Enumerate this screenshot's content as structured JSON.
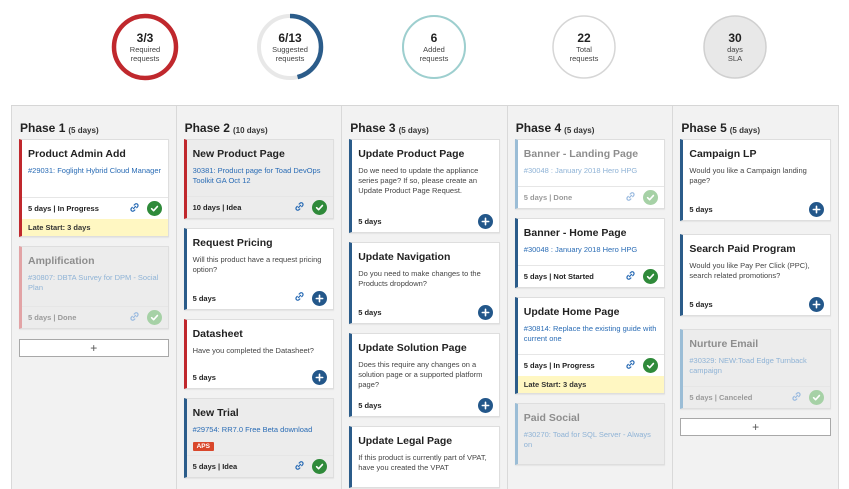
{
  "stats": [
    {
      "value": "3/3",
      "label": "Required requests",
      "ring": "#c0282d",
      "fill": 1.0
    },
    {
      "value": "6/13",
      "label": "Suggested requests",
      "ring": "#2b5c8a",
      "fill": 0.46
    },
    {
      "value": "6",
      "label": "Added requests",
      "ring": "#9dcfcf",
      "fill": 1.0
    },
    {
      "value": "22",
      "label": "Total requests",
      "ring": "#d6d6d6",
      "fill": 1.0
    },
    {
      "value": "30",
      "label": "days SLA",
      "ring": "#d0d0d0",
      "fill": 1.0
    }
  ],
  "phases": [
    {
      "title": "Phase 1",
      "days": "(5 days)"
    },
    {
      "title": "Phase 2",
      "days": "(10 days)"
    },
    {
      "title": "Phase 3",
      "days": "(5 days)"
    },
    {
      "title": "Phase 4",
      "days": "(5 days)"
    },
    {
      "title": "Phase 5",
      "days": "(5 days)"
    }
  ],
  "cards": {
    "p1c1": {
      "title": "Product Admin Add",
      "link": "#29031: Foglight Hybrid Cloud Manager",
      "status": "5 days | In Progress",
      "late": "Late Start: 3 days"
    },
    "p1c2": {
      "title": "Amplification",
      "link": "#30807: DBTA Survey for DPM - Social Plan",
      "status": "5 days | Done"
    },
    "p2c1": {
      "title": "New Product Page",
      "link": "30381: Product page for Toad DevOps Toolkit GA Oct 12",
      "status": "10 days | Idea"
    },
    "p2c2": {
      "title": "Request Pricing",
      "desc": "Will this product have a request pricing option?",
      "status": "5 days"
    },
    "p2c3": {
      "title": "Datasheet",
      "desc": "Have you completed the Datasheet?",
      "status": "5 days"
    },
    "p2c4": {
      "title": "New Trial",
      "link": "#29754: RR7.0 Free Beta download",
      "badge": "APS",
      "status": "5 days | Idea"
    },
    "p3c1": {
      "title": "Update Product Page",
      "desc": "Do we need to update the appliance series page? If so, please create an Update Product Page Request.",
      "status": "5 days"
    },
    "p3c2": {
      "title": "Update Navigation",
      "desc": "Do you need to make changes to the Products dropdown?",
      "status": "5 days"
    },
    "p3c3": {
      "title": "Update Solution Page",
      "desc": "Does this require any changes on a solution page or a supported platform page?",
      "status": "5 days"
    },
    "p3c4": {
      "title": "Update Legal Page",
      "desc": "If this product is currently part of VPAT, have you created the VPAT"
    },
    "p4c1": {
      "title": "Banner - Landing Page",
      "link": "#30048 : January 2018 Hero HPG",
      "status": "5 days | Done"
    },
    "p4c2": {
      "title": "Banner - Home Page",
      "link": "#30048 : January 2018 Hero HPG",
      "status": "5 days | Not Started"
    },
    "p4c3": {
      "title": "Update Home Page",
      "link": "#30814: Replace the existing guide with current one",
      "status": "5 days | In Progress",
      "late": "Late Start: 3 days"
    },
    "p4c4": {
      "title": "Paid Social",
      "link": "#30270: Toad for SQL Server - Always on"
    },
    "p5c1": {
      "title": "Campaign LP",
      "desc": "Would you like a Campaign landing page?",
      "status": "5 days"
    },
    "p5c2": {
      "title": "Search Paid Program",
      "desc": "Would you like Pay Per Click (PPC), search related promotions?",
      "status": "5 days"
    },
    "p5c3": {
      "title": "Nurture Email",
      "link": "#30329: NEW:Toad Edge Turnback campaign",
      "status": "5 days | Canceled"
    }
  },
  "add_label": "+",
  "icons": {
    "link": "link-icon",
    "check": "check-icon",
    "plus": "plus-icon"
  }
}
